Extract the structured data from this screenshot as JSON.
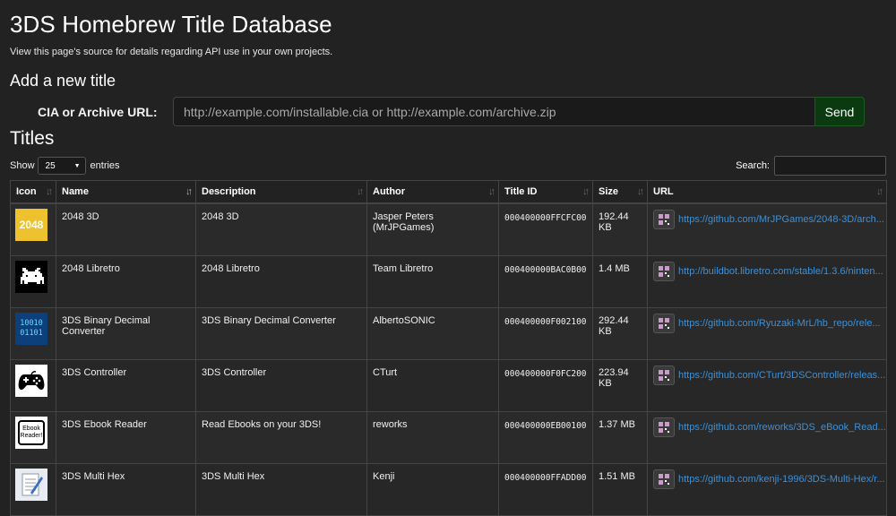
{
  "header": {
    "title": "3DS Homebrew Title Database",
    "subtitle": "View this page's source for details regarding API use in your own projects."
  },
  "add_title": {
    "heading": "Add a new title",
    "label": "CIA or Archive URL:",
    "placeholder": "http://example.com/installable.cia or http://example.com/archive.zip",
    "value": "",
    "send_label": "Send"
  },
  "titles": {
    "heading": "Titles",
    "show_label": "Show",
    "entries_value": "25",
    "entries_label": "entries",
    "search_label": "Search:",
    "search_value": ""
  },
  "table": {
    "columns": [
      "Icon",
      "Name",
      "Description",
      "Author",
      "Title ID",
      "Size",
      "URL"
    ],
    "sorted_column": "Name",
    "rows": [
      {
        "icon": "2048-tile-icon",
        "icon_text": "2048",
        "name": "2048 3D",
        "description": "2048 3D",
        "author": "Jasper Peters (MrJPGames)",
        "title_id": "000400000FFCFC00",
        "size": "192.44 KB",
        "url": "https://github.com/MrJPGames/2048-3D/arch..."
      },
      {
        "icon": "retroarch-invader-icon",
        "icon_text": "",
        "name": "2048 Libretro",
        "description": "2048 Libretro",
        "author": "Team Libretro",
        "title_id": "000400000BAC0B00",
        "size": "1.4 MB",
        "url": "http://buildbot.libretro.com/stable/1.3.6/ninten..."
      },
      {
        "icon": "binary-digits-icon",
        "icon_text": "10010 01101",
        "name": "3DS Binary Decimal Converter",
        "description": "3DS Binary Decimal Converter",
        "author": "AlbertoSONIC",
        "title_id": "000400000F002100",
        "size": "292.44 KB",
        "url": "https://github.com/Ryuzaki-MrL/hb_repo/rele..."
      },
      {
        "icon": "gamepad-icon",
        "icon_text": "",
        "name": "3DS Controller",
        "description": "3DS Controller",
        "author": "CTurt",
        "title_id": "000400000F0FC200",
        "size": "223.94 KB",
        "url": "https://github.com/CTurt/3DSController/releas..."
      },
      {
        "icon": "ebook-reader-icon",
        "icon_text": "Ebook Reader!",
        "name": "3DS Ebook Reader",
        "description": "Read Ebooks on your 3DS!",
        "author": "reworks",
        "title_id": "000400000EB00100",
        "size": "1.37 MB",
        "url": "https://github.com/reworks/3DS_eBook_Read..."
      },
      {
        "icon": "notepad-pen-icon",
        "icon_text": "",
        "name": "3DS Multi Hex",
        "description": "3DS Multi Hex",
        "author": "Kenji",
        "title_id": "000400000FFADD00",
        "size": "1.51 MB",
        "url": "https://github.com/kenji-1996/3DS-Multi-Hex/r..."
      }
    ]
  },
  "colors": {
    "background": "#222222",
    "send_button": "#0c3a10",
    "link": "#3f8fd4",
    "icon_2048": "#edc22e",
    "icon_binary": "#1e5fa8"
  }
}
